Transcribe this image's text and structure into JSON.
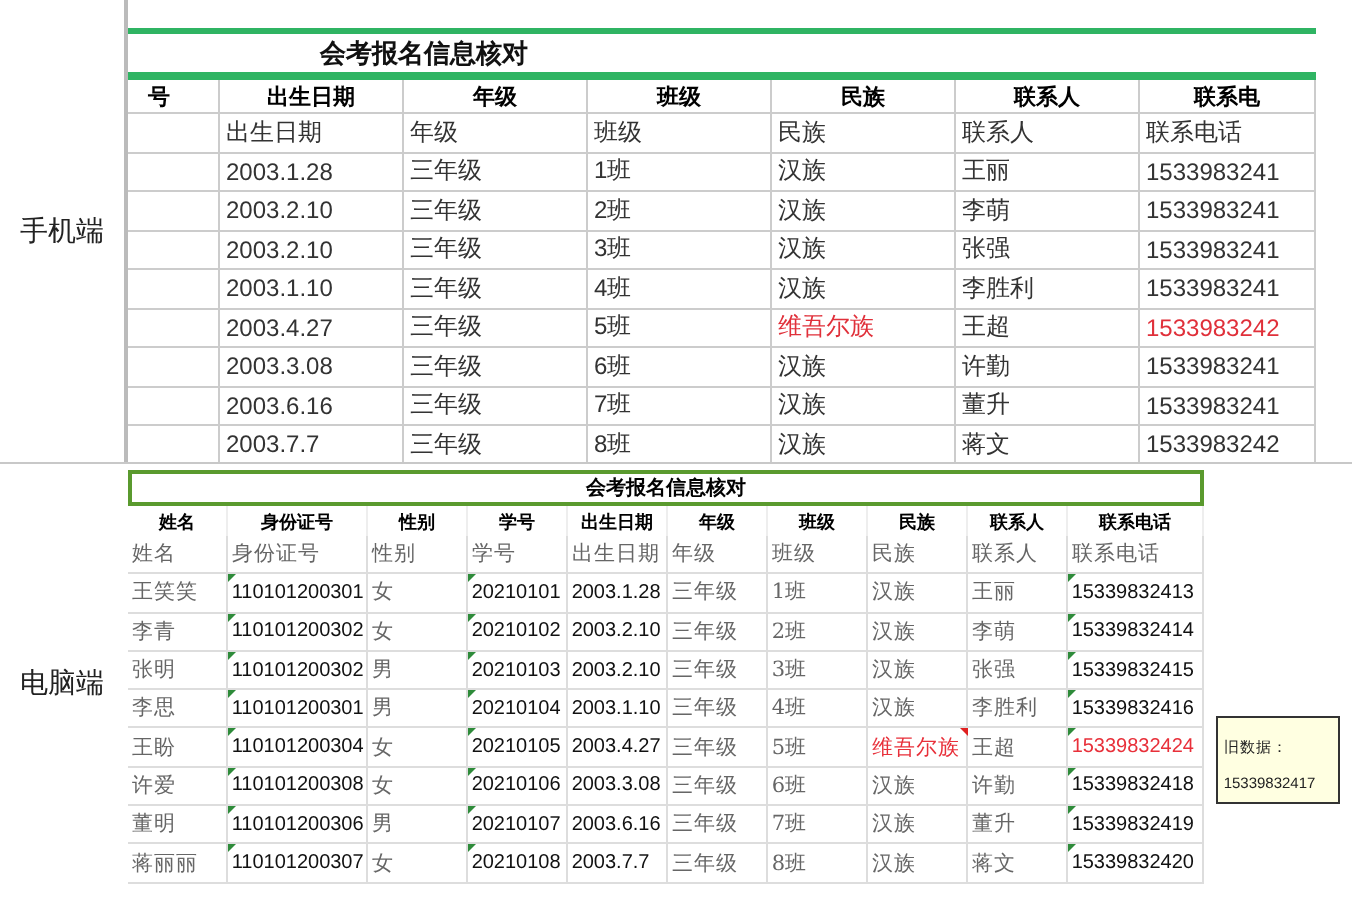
{
  "mobile": {
    "label": "手机端",
    "title": "会考报名信息核对",
    "columns": [
      {
        "label": "号",
        "kind": "plain"
      },
      {
        "label": "出生日期",
        "kind": "plain"
      },
      {
        "label": "年级",
        "kind": "plain"
      },
      {
        "label": "班级",
        "kind": "plain"
      },
      {
        "label": "民族",
        "kind": "checked"
      },
      {
        "label": "联系人",
        "kind": "plain"
      },
      {
        "label": "联系电",
        "kind": "checked"
      }
    ],
    "rows": [
      {
        "cells": [
          "",
          "出生日期",
          "年级",
          "班级",
          "民族",
          "联系人",
          "联系电话"
        ],
        "flagged": false
      },
      {
        "cells": [
          "",
          "2003.1.28",
          "三年级",
          "1班",
          "汉族",
          "王丽",
          "1533983241"
        ],
        "flagged": false
      },
      {
        "cells": [
          "",
          "2003.2.10",
          "三年级",
          "2班",
          "汉族",
          "李萌",
          "1533983241"
        ],
        "flagged": false
      },
      {
        "cells": [
          "",
          "2003.2.10",
          "三年级",
          "3班",
          "汉族",
          "张强",
          "1533983241"
        ],
        "flagged": false
      },
      {
        "cells": [
          "",
          "2003.1.10",
          "三年级",
          "4班",
          "汉族",
          "李胜利",
          "1533983241"
        ],
        "flagged": false
      },
      {
        "cells": [
          "",
          "2003.4.27",
          "三年级",
          "5班",
          "维吾尔族",
          "王超",
          "1533983242"
        ],
        "flagged": true
      },
      {
        "cells": [
          "",
          "2003.3.08",
          "三年级",
          "6班",
          "汉族",
          "许勤",
          "1533983241"
        ],
        "flagged": false
      },
      {
        "cells": [
          "",
          "2003.6.16",
          "三年级",
          "7班",
          "汉族",
          "董升",
          "1533983241"
        ],
        "flagged": false
      },
      {
        "cells": [
          "",
          "2003.7.7",
          "三年级",
          "8班",
          "汉族",
          "蒋文",
          "1533983242"
        ],
        "flagged": false
      }
    ]
  },
  "desktop": {
    "label": "电脑端",
    "title": "会考报名信息核对",
    "columns": [
      {
        "label": "姓名",
        "kind": "plain"
      },
      {
        "label": "身份证号",
        "kind": "number"
      },
      {
        "label": "性别",
        "kind": "plain"
      },
      {
        "label": "学号",
        "kind": "number"
      },
      {
        "label": "出生日期",
        "kind": "date"
      },
      {
        "label": "年级",
        "kind": "plain"
      },
      {
        "label": "班级",
        "kind": "plain"
      },
      {
        "label": "民族",
        "kind": "checked"
      },
      {
        "label": "联系人",
        "kind": "plain"
      },
      {
        "label": "联系电话",
        "kind": "checked_number"
      }
    ],
    "rows": [
      {
        "cells": [
          "姓名",
          "身份证号",
          "性别",
          "学号",
          "出生日期",
          "年级",
          "班级",
          "民族",
          "联系人",
          "联系电话"
        ],
        "flagged": false
      },
      {
        "cells": [
          "王笑笑",
          "110101200301",
          "女",
          "20210101",
          "2003.1.28",
          "三年级",
          "1班",
          "汉族",
          "王丽",
          "15339832413"
        ],
        "flagged": false
      },
      {
        "cells": [
          "李青",
          "110101200302",
          "女",
          "20210102",
          "2003.2.10",
          "三年级",
          "2班",
          "汉族",
          "李萌",
          "15339832414"
        ],
        "flagged": false
      },
      {
        "cells": [
          "张明",
          "110101200302",
          "男",
          "20210103",
          "2003.2.10",
          "三年级",
          "3班",
          "汉族",
          "张强",
          "15339832415"
        ],
        "flagged": false
      },
      {
        "cells": [
          "李思",
          "110101200301",
          "男",
          "20210104",
          "2003.1.10",
          "三年级",
          "4班",
          "汉族",
          "李胜利",
          "15339832416"
        ],
        "flagged": false
      },
      {
        "cells": [
          "王盼",
          "110101200304",
          "女",
          "20210105",
          "2003.4.27",
          "三年级",
          "5班",
          "维吾尔族",
          "王超",
          "15339832424"
        ],
        "flagged": true
      },
      {
        "cells": [
          "许爱",
          "110101200308",
          "女",
          "20210106",
          "2003.3.08",
          "三年级",
          "6班",
          "汉族",
          "许勤",
          "15339832418"
        ],
        "flagged": false
      },
      {
        "cells": [
          "董明",
          "110101200306",
          "男",
          "20210107",
          "2003.6.16",
          "三年级",
          "7班",
          "汉族",
          "董升",
          "15339832419"
        ],
        "flagged": false
      },
      {
        "cells": [
          "蒋丽丽",
          "110101200307",
          "女",
          "20210108",
          "2003.7.7",
          "三年级",
          "8班",
          "汉族",
          "蒋文",
          "15339832420"
        ],
        "flagged": false
      }
    ],
    "comment": {
      "text": "旧数据：15339832417"
    }
  }
}
